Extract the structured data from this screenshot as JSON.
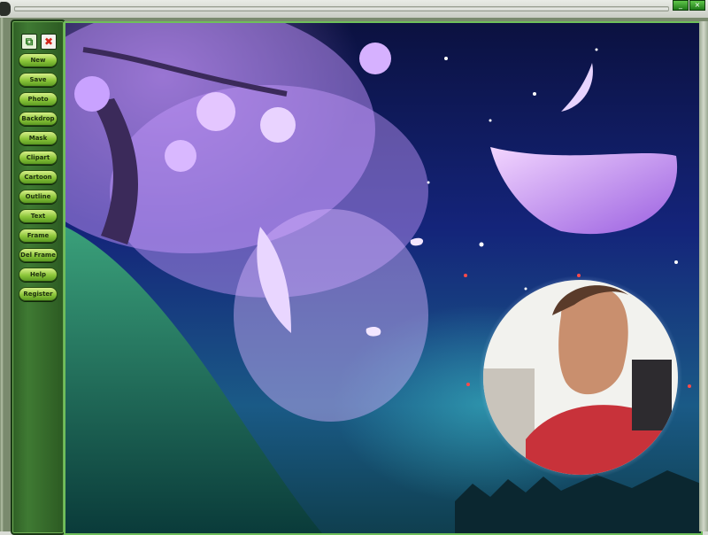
{
  "window": {
    "buttons": [
      {
        "name": "minimize",
        "glyph": "_"
      },
      {
        "name": "close",
        "glyph": "×"
      }
    ]
  },
  "toolbar_icons": [
    {
      "name": "copy-icon"
    },
    {
      "name": "close-icon",
      "glyph": "✖"
    }
  ],
  "menu": {
    "items": [
      {
        "label": "New"
      },
      {
        "label": "Save"
      },
      {
        "label": "Photo"
      },
      {
        "label": "Backdrop"
      },
      {
        "label": "Mask"
      },
      {
        "label": "Clipart"
      },
      {
        "label": "Cartoon"
      },
      {
        "label": "Outline"
      },
      {
        "label": "Text"
      },
      {
        "label": "Frame"
      },
      {
        "label": "Del Frame"
      },
      {
        "label": "Help"
      },
      {
        "label": "Register"
      }
    ]
  },
  "colors": {
    "sidebar": "#3f7a33",
    "button": "#8cc63a",
    "canvas_border": "#6fbf5a",
    "sky_top": "#0b1140",
    "sky_bottom": "#1a5a86"
  }
}
